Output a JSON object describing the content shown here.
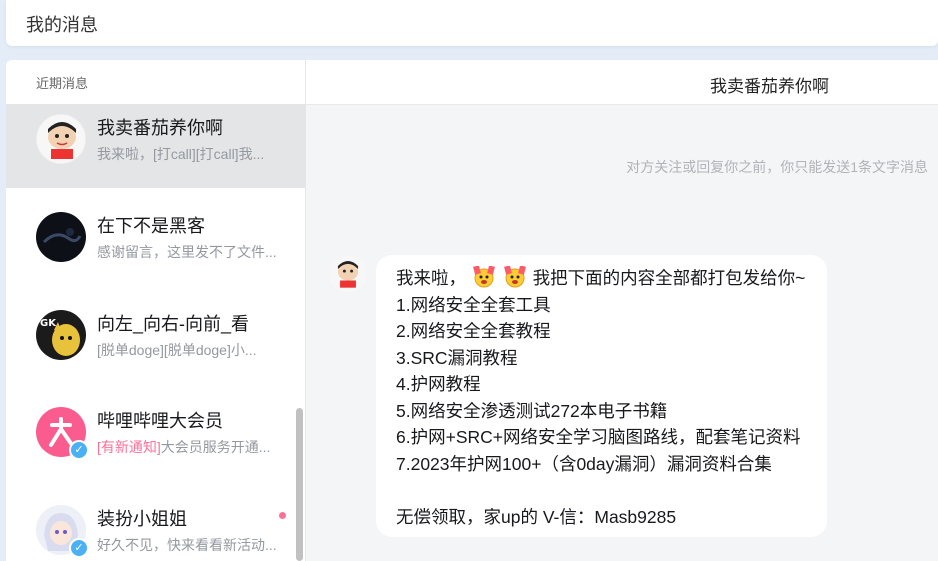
{
  "header": {
    "title": "我的消息"
  },
  "sidebar": {
    "heading": "近期消息",
    "conversations": [
      {
        "name": "我卖番茄养你啊",
        "preview": "我来啦，[打call][打call]我...",
        "active": true
      },
      {
        "name": "在下不是黑客",
        "preview": "感谢留言，这里发不了文件..."
      },
      {
        "name": "向左_向右-向前_看",
        "preview": "[脱单doge][脱单doge]小..."
      },
      {
        "name": "哔哩哔哩大会员",
        "tag": "[有新通知]",
        "preview": "大会员服务开通..."
      },
      {
        "name": "装扮小姐姐",
        "preview": "好久不见，快来看看新活动...",
        "unread": true
      }
    ]
  },
  "chat": {
    "title": "我卖番茄养你啊",
    "notice": "对方关注或回复你之前，你只能发送1条文字消息",
    "message": {
      "intro": "我来啦，",
      "intro_tail": "我把下面的内容全部都打包发给你~",
      "emojis": [
        "打call",
        "打call"
      ],
      "lines": [
        "1.网络安全全套工具",
        "2.网络安全全套教程",
        "3.SRC漏洞教程",
        "4.护网教程",
        "5.网络安全渗透测试272本电子书籍",
        "6.护网+SRC+网络安全学习脑图路线，配套笔记资料",
        "7.2023年护网100+（含0day漏洞）漏洞资料合集"
      ],
      "footer": "无偿领取，家up的 V-信：Masb9285"
    }
  },
  "colors": {
    "accent_pink": "#fb7299",
    "verify_blue": "#4cb0f5",
    "active_row": "#e4e5e6"
  }
}
